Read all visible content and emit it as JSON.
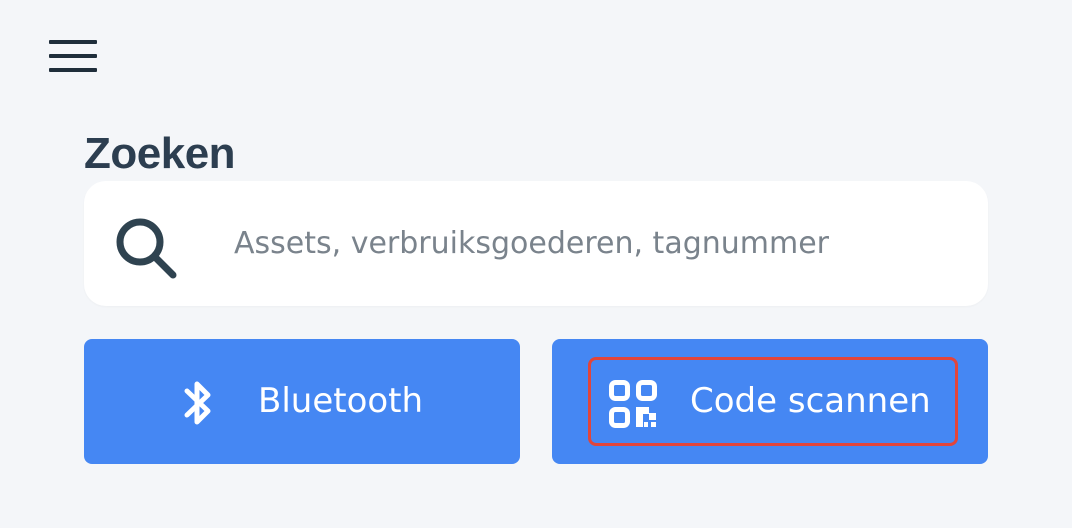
{
  "header": {
    "menu_icon": "hamburger-menu-icon"
  },
  "search": {
    "title": "Zoeken",
    "placeholder": "Assets, verbruiksgoederen, tagnummer",
    "value": "",
    "icon": "search-icon"
  },
  "actions": {
    "bluetooth": {
      "label": "Bluetooth",
      "icon": "bluetooth-icon"
    },
    "scan": {
      "label": "Code scannen",
      "icon": "qr-code-icon"
    }
  },
  "colors": {
    "background": "#f4f6f9",
    "title": "#2c3e50",
    "button": "#4587f3",
    "placeholder": "#7a838c",
    "highlight": "#e2453a"
  }
}
